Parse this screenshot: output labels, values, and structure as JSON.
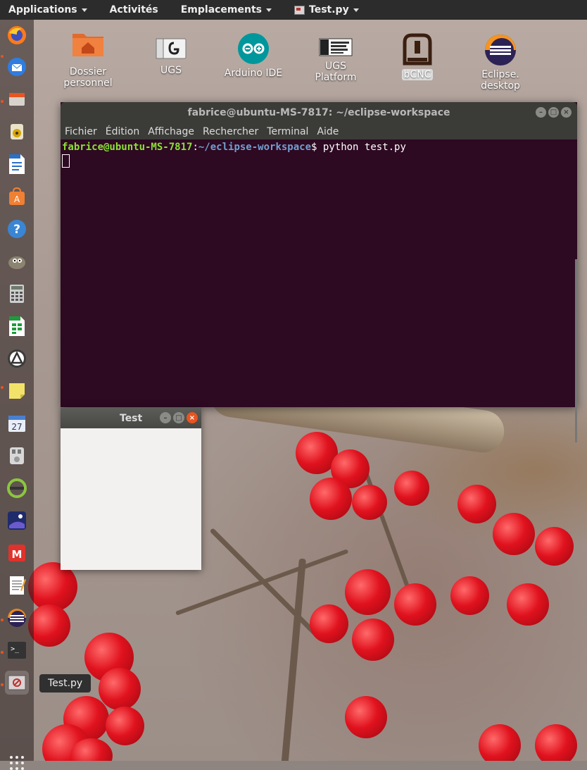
{
  "topbar": {
    "applications": "Applications",
    "activities": "Activités",
    "places": "Emplacements",
    "active_app": "Test.py"
  },
  "dock": {
    "items": [
      "firefox-icon",
      "thunderbird-icon",
      "files-icon",
      "rhythmbox-icon",
      "writer-icon",
      "software-center-icon",
      "help-icon",
      "gimp-icon",
      "calculator-icon",
      "calc-spreadsheet-icon",
      "ubuntu-one-icon",
      "notes-icon",
      "calendar-icon",
      "usb-creator-icon",
      "openscad-icon",
      "stellarium-icon",
      "pdf-editor-icon",
      "text-editor-icon",
      "eclipse-icon",
      "terminal-icon",
      "testpy-icon"
    ],
    "tooltip": "Test.py"
  },
  "desktop": {
    "icons": [
      {
        "label_line1": "Dossier",
        "label_line2": "personnel"
      },
      {
        "label_line1": "UGS",
        "label_line2": ""
      },
      {
        "label_line1": "Arduino IDE",
        "label_line2": ""
      },
      {
        "label_line1": "UGS",
        "label_line2": "Platform"
      },
      {
        "label_line1": "bCNC",
        "label_line2": ""
      },
      {
        "label_line1": "Eclipse.",
        "label_line2": "desktop"
      }
    ]
  },
  "terminal": {
    "title": "fabrice@ubuntu-MS-7817: ~/eclipse-workspace",
    "menu": [
      "Fichier",
      "Édition",
      "Affichage",
      "Rechercher",
      "Terminal",
      "Aide"
    ],
    "prompt_user": "fabrice@ubuntu-MS-7817",
    "prompt_sep": ":",
    "prompt_path": "~/eclipse-workspace",
    "prompt_symbol": "$",
    "command": "python test.py"
  },
  "test_window": {
    "title": "Test"
  },
  "colors": {
    "terminal_bg": "#2d0922",
    "accent": "#e95420",
    "prompt_user": "#8ae234",
    "prompt_path": "#729fcf"
  }
}
